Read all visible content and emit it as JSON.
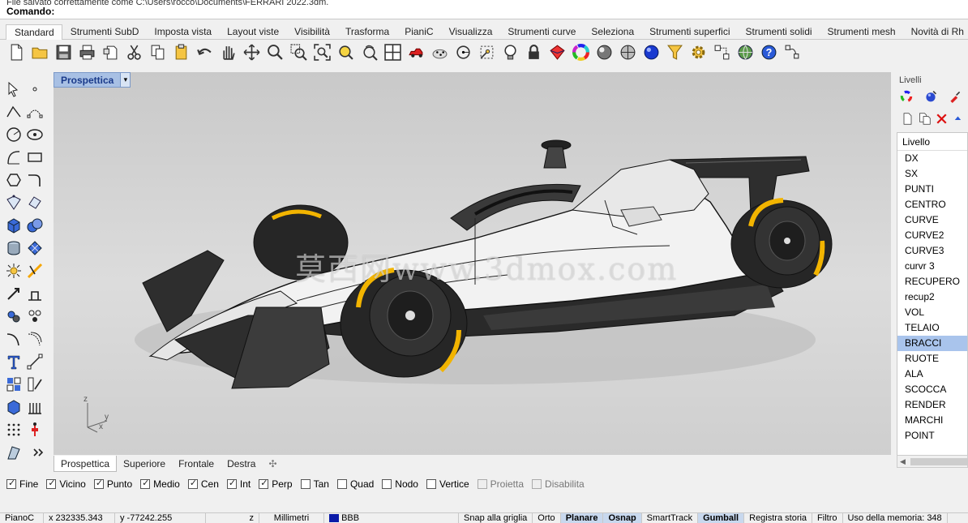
{
  "command": {
    "history": "File salvato correttamente come C:\\Users\\rocco\\Documents\\FERRARI 2022.3dm.",
    "label": "Comando:",
    "input_value": ""
  },
  "tabs": [
    "Standard",
    "Strumenti SubD",
    "Imposta vista",
    "Layout viste",
    "Visibilità",
    "Trasforma",
    "PianiC",
    "Visualizza",
    "Strumenti curve",
    "Seleziona",
    "Strumenti superfici",
    "Strumenti solidi",
    "Strumenti mesh",
    "Novità di Rh"
  ],
  "active_tab": "Standard",
  "toolbar_icons": [
    "new-file-icon",
    "open-folder-icon",
    "save-icon",
    "print-icon",
    "import-icon",
    "cut-icon",
    "copy-icon",
    "paste-icon",
    "undo-icon",
    "pan-hand-icon",
    "rotate-view-icon",
    "zoom-icon",
    "zoom-window-icon",
    "zoom-extents-icon",
    "zoom-selected-icon",
    "rotate-camera-icon",
    "four-viewports-icon",
    "car-icon",
    "point-cloud-icon",
    "circle-dot-icon",
    "grid-snap-icon",
    "light-bulb-icon",
    "lock-icon",
    "material-icon",
    "color-wheel-icon",
    "render-sphere-icon",
    "shaded-sphere-icon",
    "blue-sphere-icon",
    "filter-icon",
    "gear-icon",
    "transform-icon",
    "globe-icon",
    "help-icon",
    "analyze-icon"
  ],
  "viewport": {
    "title": "Prospettica",
    "watermark": "莫西网www.3dmox.com",
    "axis_z": "z",
    "axis_x": "x",
    "axis_y": "y"
  },
  "viewport_tabs": [
    "Prospettica",
    "Superiore",
    "Frontale",
    "Destra"
  ],
  "add_viewport_symbol": "✣",
  "osnaps": [
    {
      "label": "Fine",
      "checked": true
    },
    {
      "label": "Vicino",
      "checked": true
    },
    {
      "label": "Punto",
      "checked": true
    },
    {
      "label": "Medio",
      "checked": true
    },
    {
      "label": "Cen",
      "checked": true
    },
    {
      "label": "Int",
      "checked": true
    },
    {
      "label": "Perp",
      "checked": true
    },
    {
      "label": "Tan",
      "checked": false
    },
    {
      "label": "Quad",
      "checked": false
    },
    {
      "label": "Nodo",
      "checked": false
    },
    {
      "label": "Vertice",
      "checked": false
    },
    {
      "label": "Proietta",
      "checked": false,
      "disabled": true
    },
    {
      "label": "Disabilita",
      "checked": false,
      "disabled": true
    }
  ],
  "status_bar": {
    "cplane": "PianoC",
    "x": "x 232335.343",
    "y": "y -77242.255",
    "z": "z",
    "units": "Millimetri",
    "layer": "BBB",
    "layer_color": "#0a1aa8",
    "grid_snap": "Snap alla griglia",
    "ortho": "Orto",
    "planar": "Planare",
    "osnap": "Osnap",
    "smarttrack": "SmartTrack",
    "gumball": "Gumball",
    "history": "Registra storia",
    "filter": "Filtro",
    "memory": "Uso della memoria: 348"
  },
  "layers_panel": {
    "title": "Livelli",
    "header": "Livello",
    "layers": [
      "DX",
      "SX",
      "PUNTI",
      "CENTRO",
      "CURVE",
      "CURVE2",
      "CURVE3",
      "curvr 3",
      "RECUPERO",
      "recup2",
      "VOL",
      "TELAIO",
      "BRACCI",
      "RUOTE",
      "ALA",
      "SCOCCA",
      "RENDER",
      "MARCHI",
      "POINT"
    ],
    "selected": "BRACCI"
  },
  "colors": {
    "accent": "#a9c4ec",
    "viewport_title_bg": "#a8c0e4",
    "tire_stripe": "#f2b400"
  }
}
